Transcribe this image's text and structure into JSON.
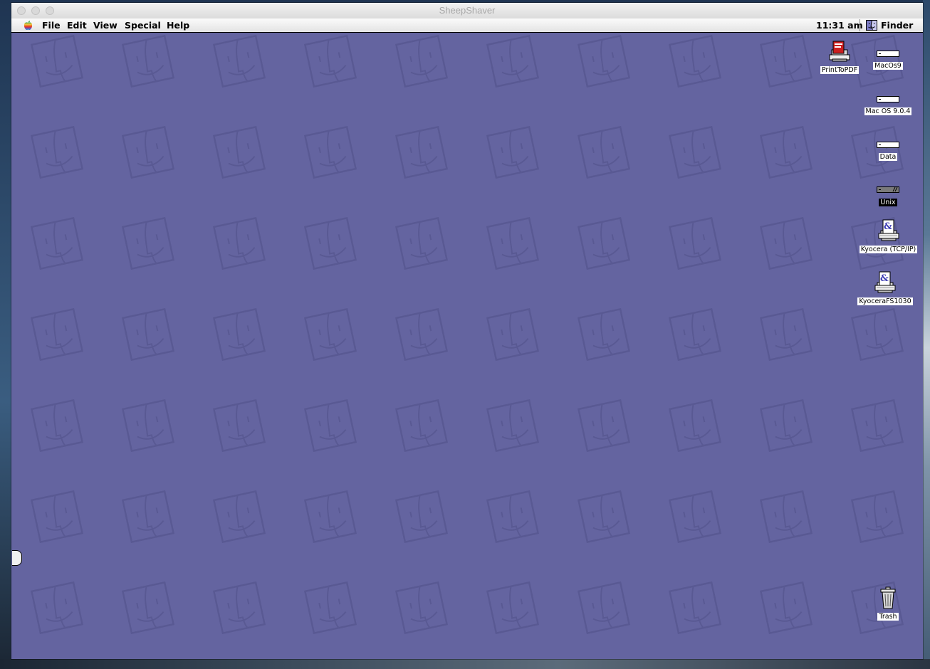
{
  "window": {
    "title": "SheepShaver"
  },
  "menubar": {
    "apple_icon": "apple-rainbow-icon",
    "items": [
      {
        "label": "File"
      },
      {
        "label": "Edit"
      },
      {
        "label": "View"
      },
      {
        "label": "Special"
      },
      {
        "label": "Help"
      }
    ],
    "clock": "11:31 am",
    "app_menu": {
      "icon": "finder-icon",
      "label": "Finder"
    }
  },
  "desktop": {
    "pattern": "finder-face-pattern",
    "background_color": "#6464a0",
    "icons": [
      {
        "label": "PrintToPDF",
        "icon": "pdf-printer-icon"
      },
      {
        "label": "MacOs9",
        "icon": "hard-disk-icon"
      },
      {
        "label": "Mac OS 9.0.4",
        "icon": "hard-disk-icon"
      },
      {
        "label": "Data",
        "icon": "hard-disk-icon"
      },
      {
        "label": "Unix",
        "icon": "network-disk-icon",
        "selected": true
      },
      {
        "label": "Kyocera (TCP/IP)",
        "icon": "desktop-printer-icon"
      },
      {
        "label": "KyoceraFS1030",
        "icon": "desktop-printer-icon"
      },
      {
        "label": "Trash",
        "icon": "trash-icon"
      }
    ]
  }
}
